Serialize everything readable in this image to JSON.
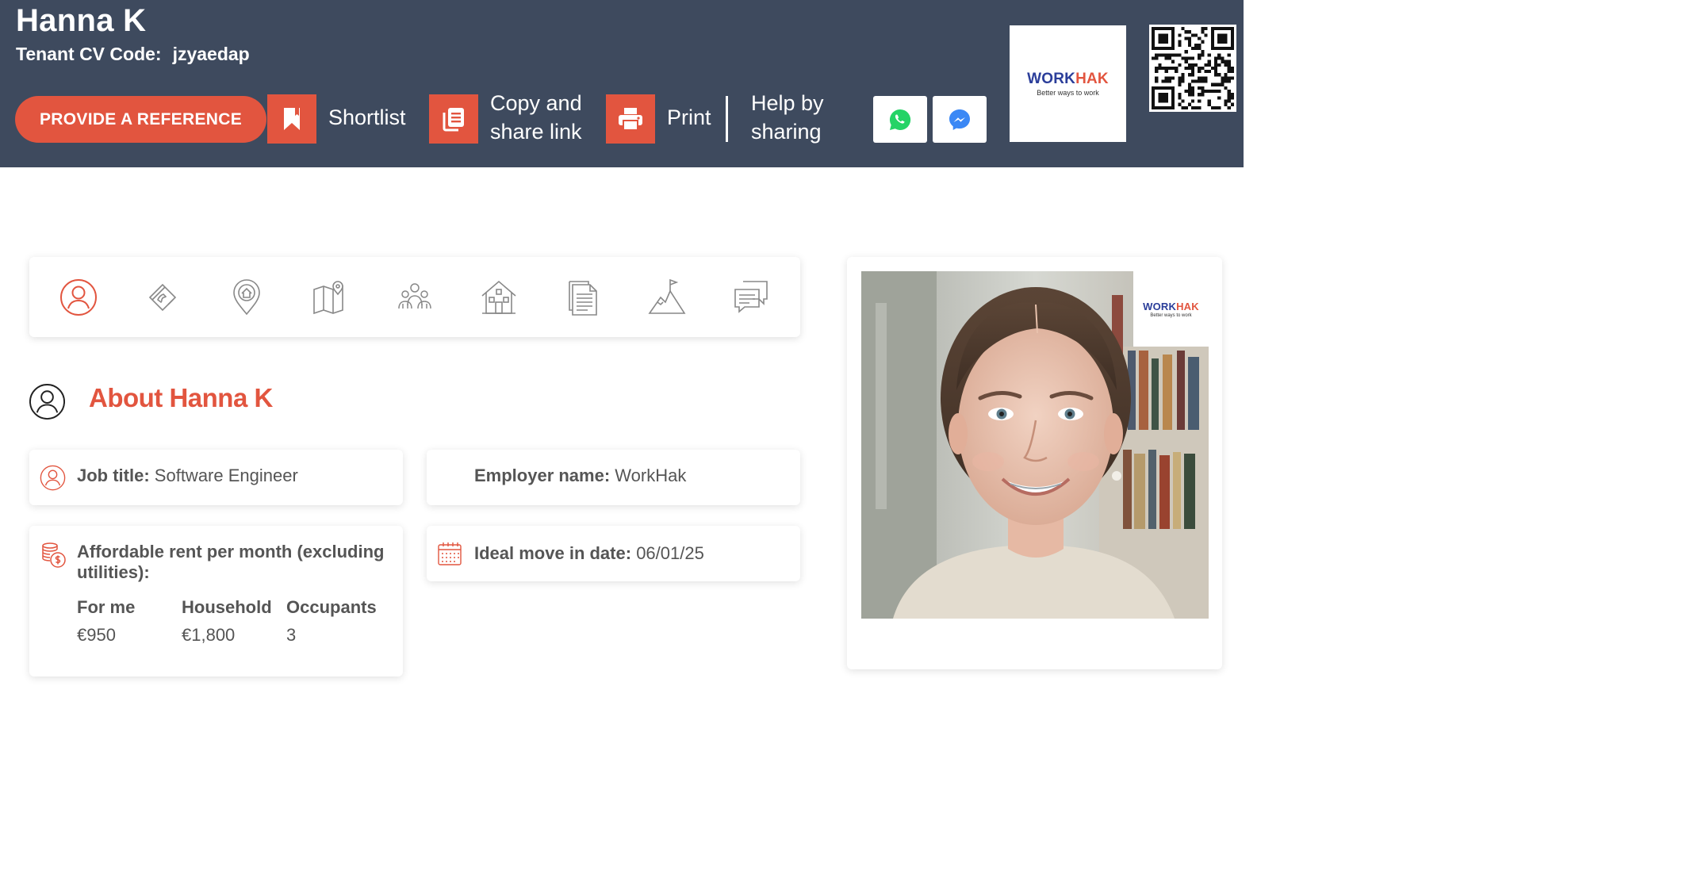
{
  "header": {
    "name": "Hanna K",
    "cv_code_label": "Tenant CV Code:",
    "cv_code": "jzyaedap",
    "reference_button": "PROVIDE A REFERENCE",
    "shortlist_label": "Shortlist",
    "copy_label_line1": "Copy and",
    "copy_label_line2": "share link",
    "print_label": "Print",
    "help_line1": "Help by",
    "help_line2": "sharing",
    "share_buttons": [
      "whatsapp-icon",
      "messenger-icon"
    ],
    "logo": {
      "word1": "WORK",
      "word2": "HAK",
      "tagline": "Better ways to work"
    },
    "accent": "#e2553f",
    "bar_color": "#3e4a5e"
  },
  "nav_icons": [
    "person-icon",
    "phone-book-icon",
    "location-home-icon",
    "map-icon",
    "family-icon",
    "house-icon",
    "document-icon",
    "mountain-flag-icon",
    "chat-icon"
  ],
  "about": {
    "title": "About Hanna K",
    "job_title_label": "Job title:",
    "job_title": "Software Engineer",
    "employer_label": "Employer name:",
    "employer": "WorkHak",
    "rent_label_line1": "Affordable rent per month (excluding",
    "rent_label_line2": "utilities):",
    "rent_columns": [
      {
        "header": "For me",
        "value": "€950"
      },
      {
        "header": "Household",
        "value": "€1,800"
      },
      {
        "header": "Occupants",
        "value": "3"
      }
    ],
    "move_in_label": "Ideal move in date:",
    "move_in_date": "06/01/25"
  },
  "photo": {
    "logo": {
      "word1": "WORK",
      "word2": "HAK",
      "tagline": "Better ways to work"
    }
  }
}
